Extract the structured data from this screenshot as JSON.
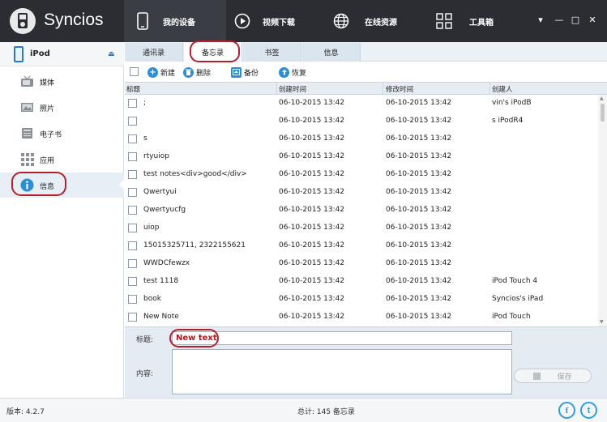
{
  "app": {
    "name": "Syncios",
    "version_label": "版本: 4.2.7"
  },
  "colors": {
    "topbar": "#2b2d33",
    "accent": "#2a7ac8",
    "highlight_ring": "#b5202a",
    "new_text": "#c0111a"
  },
  "topnav": [
    {
      "label": "我的设备",
      "icon": "phone-icon",
      "active": true
    },
    {
      "label": "视频下载",
      "icon": "play-icon",
      "active": false
    },
    {
      "label": "在线资源",
      "icon": "globe-icon",
      "active": false
    },
    {
      "label": "工具箱",
      "icon": "toolbox-icon",
      "active": false
    }
  ],
  "window_controls": {
    "menu": "▾",
    "minimize": "—",
    "maximize": "□",
    "close": "✕"
  },
  "sidebar": {
    "device_name": "iPod",
    "device_icon": "ipod-icon",
    "eject_icon": "eject-icon",
    "items": [
      {
        "label": "媒体",
        "icon": "tv-icon",
        "active": false
      },
      {
        "label": "照片",
        "icon": "photo-icon",
        "active": false
      },
      {
        "label": "电子书",
        "icon": "book-icon",
        "active": false
      },
      {
        "label": "应用",
        "icon": "apps-icon",
        "active": false
      },
      {
        "label": "信息",
        "icon": "info-icon",
        "active": true
      }
    ]
  },
  "tabs": [
    {
      "label": "通讯录",
      "active": false
    },
    {
      "label": "备忘录",
      "active": true
    },
    {
      "label": "书签",
      "active": false
    },
    {
      "label": "信息",
      "active": false
    }
  ],
  "toolbar": {
    "new_label": "新建",
    "delete_label": "删除",
    "backup_label": "备份",
    "restore_label": "恢复"
  },
  "table": {
    "columns": [
      "标题",
      "创建时间",
      "修改时间",
      "创建人"
    ],
    "rows": [
      {
        "title": ";",
        "created": "06-10-2015 13:42",
        "modified": "06-10-2015 13:42",
        "creator": "vin's iPodB"
      },
      {
        "title": "",
        "created": "06-10-2015 13:42",
        "modified": "06-10-2015 13:42",
        "creator": "s iPodR4"
      },
      {
        "title": "s",
        "created": "06-10-2015 13:42",
        "modified": "06-10-2015 13:42",
        "creator": ""
      },
      {
        "title": "rtyuiop",
        "created": "06-10-2015 13:42",
        "modified": "06-10-2015 13:42",
        "creator": ""
      },
      {
        "title": "test notes<div>good</div>",
        "created": "06-10-2015 13:42",
        "modified": "06-10-2015 13:42",
        "creator": ""
      },
      {
        "title": "Qwertyui",
        "created": "06-10-2015 13:42",
        "modified": "06-10-2015 13:42",
        "creator": ""
      },
      {
        "title": "Qwertyucfg",
        "created": "06-10-2015 13:42",
        "modified": "06-10-2015 13:42",
        "creator": ""
      },
      {
        "title": "uiop",
        "created": "06-10-2015 13:42",
        "modified": "06-10-2015 13:42",
        "creator": ""
      },
      {
        "title": "15015325711, 2322155621",
        "created": "06-10-2015 13:42",
        "modified": "06-10-2015 13:42",
        "creator": ""
      },
      {
        "title": "WWDCfewzx",
        "created": "06-10-2015 13:42",
        "modified": "06-10-2015 13:42",
        "creator": ""
      },
      {
        "title": "test 1118",
        "created": "06-10-2015 13:42",
        "modified": "06-10-2015 13:42",
        "creator": "iPod Touch 4"
      },
      {
        "title": "book",
        "created": "06-10-2015 13:42",
        "modified": "06-10-2015 13:42",
        "creator": "Syncios's iPad"
      },
      {
        "title": "New Note",
        "created": "06-10-2015 13:42",
        "modified": "06-10-2015 13:42",
        "creator": "iPod Touch"
      }
    ]
  },
  "editor": {
    "title_label": "标题:",
    "title_value": "New text",
    "content_label": "内容:",
    "content_value": "",
    "save_label": "保存"
  },
  "footer": {
    "total_label": "总计: 145 备忘录",
    "facebook_glyph": "f",
    "twitter_glyph": "t"
  }
}
